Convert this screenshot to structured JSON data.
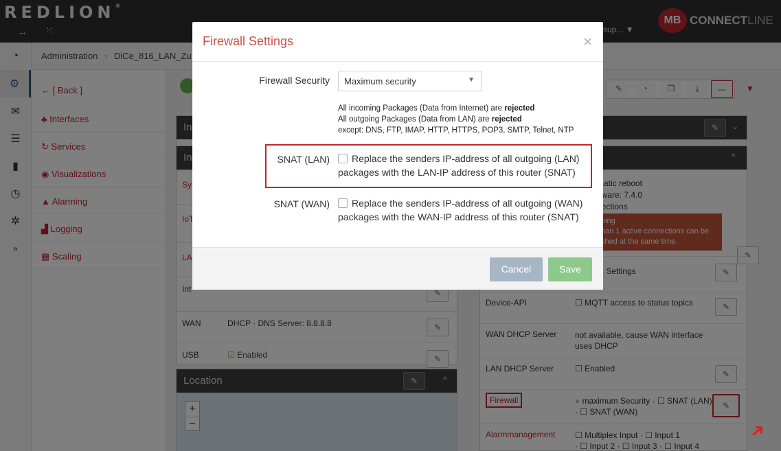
{
  "topbar": {
    "logo": "REDLION",
    "logo_reg": "®",
    "user_label": "sup...",
    "mb": "MB",
    "connect": "CONNECT",
    "line": "LINE"
  },
  "breadcrumb": {
    "root": "Administration",
    "separator": "›",
    "device": "DiCe_816_LAN_Zu"
  },
  "sidebar": {
    "items": [
      {
        "label": "[ Back ]",
        "icon": "arrow-left-icon"
      },
      {
        "label": "Interfaces",
        "icon": "network-icon"
      },
      {
        "label": "Services",
        "icon": "refresh-icon"
      },
      {
        "label": "Visualizations",
        "icon": "dashboard-icon"
      },
      {
        "label": "Alarming",
        "icon": "warning-icon"
      },
      {
        "label": "Logging",
        "icon": "chart-icon"
      },
      {
        "label": "Scaling",
        "icon": "table-icon"
      }
    ]
  },
  "background": {
    "left_panel": {
      "wan_label": "WAN",
      "wan_value": "DHCP  · DNS Server: 8.8.8.8",
      "usb_label": "USB",
      "usb_value": "Enabled",
      "location_title": "Location",
      "row_abbrev_1": "In",
      "row_abbrev_2": "In",
      "row_abbrev_3": "Sys",
      "row_abbrev_4": "IoT",
      "row_abbrev_5": "LAI",
      "row_abbrev_6": "Int"
    },
    "right_panel": {
      "auto_reboot": "matic reboot",
      "firmware": "nware: 7.4.0",
      "connections": "nections",
      "warning_1": "ning",
      "warning_2": "han 1 active connections can be",
      "warning_3": "shed at the same time.",
      "static_settings": "tic Settings",
      "device_api_label": "Device-API",
      "device_api_value": "MQTT access to status topics",
      "wan_dhcp_label": "WAN DHCP Server",
      "wan_dhcp_value": "not available, cause WAN interface uses DHCP",
      "lan_dhcp_label": "LAN DHCP Server",
      "lan_dhcp_value": "Enabled",
      "firewall_label": "Firewall",
      "firewall_value_1": "maximum Security  · ☐ SNAT (LAN)",
      "firewall_value_2": "· ☐ SNAT (WAN)",
      "alarm_label": "Alarmmanagement",
      "alarm_value_1": "☐ Multiplex Input  · ☐ Input 1",
      "alarm_value_2": "· ☐ Input 2  · ☐ Input 3  · ☐ Input 4"
    }
  },
  "modal": {
    "title": "Firewall Settings",
    "close": "×",
    "firewall_security_label": "Firewall Security",
    "firewall_security_value": "Maximum security",
    "info_line1_pre": "All incoming Packages (Data from Internet) are ",
    "info_line1_bold": "rejected",
    "info_line2_pre": "All outgoing Packages (Data from LAN) are ",
    "info_line2_bold": "rejected",
    "info_line3": "except: DNS, FTP, IMAP, HTTP, HTTPS, POP3, SMTP, Telnet, NTP",
    "snat_lan_label": "SNAT (LAN)",
    "snat_lan_text": "Replace the senders IP-address of all outgoing (LAN) packages with the LAN-IP address of this router (SNAT)",
    "snat_wan_label": "SNAT (WAN)",
    "snat_wan_text": "Replace the senders IP-address of all outgoing (WAN) packages with the WAN-IP address of this router (SNAT)",
    "cancel": "Cancel",
    "save": "Save"
  },
  "colors": {
    "accent_red": "#c0272d",
    "title_red": "#c9514a",
    "save_green": "#8dc98a",
    "cancel_gray": "#a7b6c5"
  }
}
